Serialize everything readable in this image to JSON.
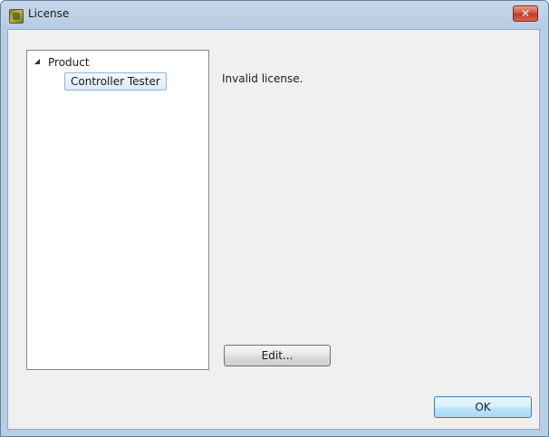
{
  "window": {
    "title": "License",
    "close_glyph": "✕"
  },
  "tree": {
    "root_label": "Product",
    "children": [
      {
        "label": "Controller Tester",
        "selected": true
      }
    ]
  },
  "main": {
    "message": "Invalid license.",
    "edit_label": "Edit..."
  },
  "footer": {
    "ok_label": "OK"
  },
  "colors": {
    "accent": "#3c7fb1",
    "close": "#c23a22",
    "selection": "#dcebfb"
  },
  "icons": {
    "app": "license-app-icon",
    "close": "close-icon",
    "expander": "tree-expander-icon"
  }
}
